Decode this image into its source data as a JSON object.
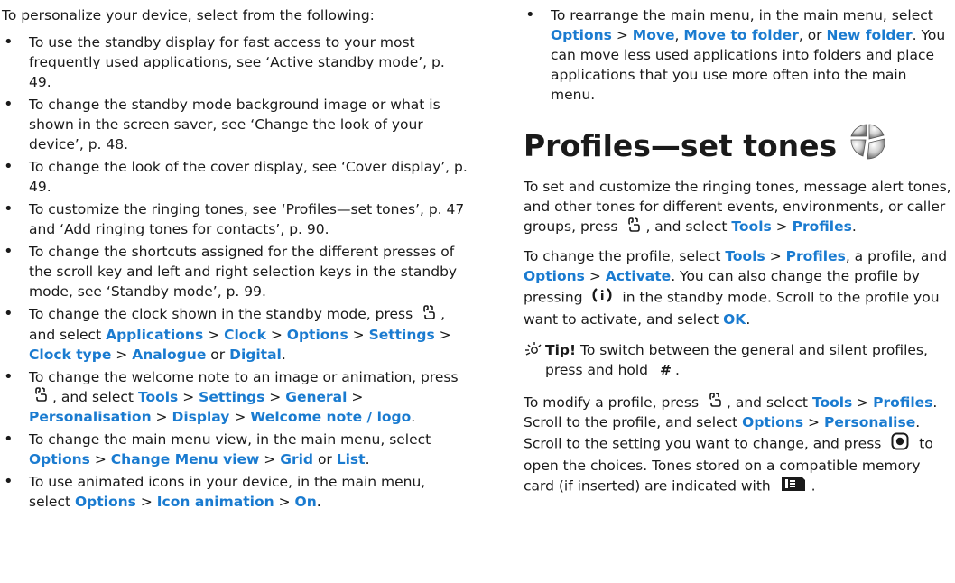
{
  "left": {
    "intro": "To personalize your device, select from the following:",
    "b1": {
      "text": "To use the standby display for fast access to your most frequently used applications, see ‘Active standby mode’, p. 49."
    },
    "b2": {
      "text": "To change the standby mode background image or what is shown in the screen saver, see ‘Change the look of your device’, p. 48."
    },
    "b3": {
      "text": "To change the look of the cover display, see ‘Cover display’, p. 49."
    },
    "b4": {
      "text": "To customize the ringing tones, see ‘Profiles—set tones’, p. 47 and ‘Add ringing tones for contacts’, p. 90."
    },
    "b5": {
      "text": "To change the shortcuts assigned for the different presses of the scroll key and left and right selection keys in the standby mode, see ‘Standby mode’, p. 99."
    },
    "b6": {
      "pre": "To change the clock shown in the standby mode, press",
      "mid": ", and select",
      "k1": "Applications",
      "k2": "Clock",
      "k3": "Options",
      "k4": "Settings",
      "k5": "Clock type",
      "k6": "Analogue",
      "or": "or",
      "k7": "Digital",
      "end": "."
    },
    "b7": {
      "pre": "To change the welcome note to an image or animation, press",
      "mid": ", and select",
      "k1": "Tools",
      "k2": "Settings",
      "k3": "General",
      "k4": "Personalisation",
      "k5": "Display",
      "k6": "Welcome note / logo",
      "end": "."
    },
    "b8": {
      "pre": "To change the main menu view, in the main menu, select",
      "k1": "Options",
      "k2": "Change Menu view",
      "k3": "Grid",
      "or": "or",
      "k4": "List",
      "end": "."
    },
    "b9": {
      "pre": "To use animated icons in your device, in the main menu, select",
      "k1": "Options",
      "k2": "Icon animation",
      "k3": "On",
      "end": "."
    }
  },
  "right": {
    "b10": {
      "pre": "To rearrange the main menu, in the main menu, select",
      "k1": "Options",
      "k2": "Move",
      "k3": "Move to folder",
      "or": ", or",
      "k4": "New folder",
      "post": ". You can move less used applications into folders and place applications that you use more often into the main menu."
    },
    "heading": "Profiles—set tones",
    "p1": {
      "pre": "To set and customize the ringing tones, message alert tones, and other tones for different events, environments, or caller groups, press",
      "mid": ", and select",
      "k1": "Tools",
      "k2": "Profiles",
      "end": "."
    },
    "p2": {
      "pre": "To change the profile, select",
      "k1": "Tools",
      "k2": "Profiles",
      "mid": ", a profile, and",
      "k3": "Options",
      "k4": "Activate",
      "mid2": ". You can also change the profile by pressing",
      "mid3": "in the standby mode. Scroll to the profile you want to activate, and select",
      "k5": "OK",
      "end": "."
    },
    "tip": {
      "label": "Tip!",
      "pre": "To switch between the general and silent profiles, press and hold",
      "key": "#",
      "end": "."
    },
    "p3": {
      "pre": "To modify a profile, press",
      "mid": ", and select",
      "k1": "Tools",
      "k2": "Profiles",
      "mid2": ". Scroll to the profile, and select",
      "k3": "Options",
      "k4": "Personalise",
      "mid3": ". Scroll to the setting you want to change, and press",
      "mid4": "to open the choices. Tones stored on a compatible memory card (if inserted) are indicated with",
      "end": "."
    }
  },
  "sep": ">"
}
